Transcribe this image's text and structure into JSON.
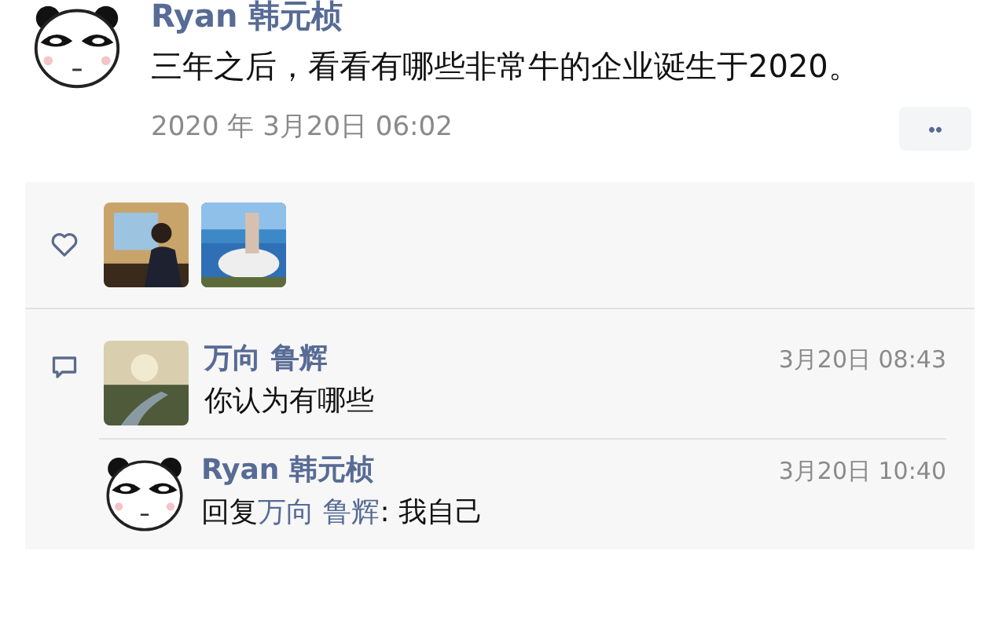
{
  "post": {
    "author": "Ryan 韩元桢",
    "text": "三年之后，看看有哪些非常牛的企业诞生于2020。",
    "time": "2020 年 3月20日 06:02",
    "more": "••"
  },
  "comments": [
    {
      "kind": "comment",
      "author": "万向 鲁辉",
      "time": "3月20日 08:43",
      "text": "你认为有哪些"
    },
    {
      "kind": "reply",
      "avatar": {
        "kind": "panda"
      },
      "author": "Ryan 韩元桢",
      "time": "3月20日 10:40",
      "reply_prefix": "回复",
      "reply_to": "万向 鲁辉",
      "text": ": 我自己"
    }
  ]
}
